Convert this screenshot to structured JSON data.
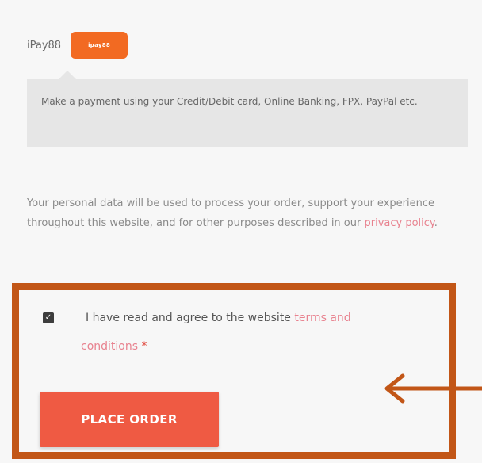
{
  "payment": {
    "method_name": "iPay88",
    "badge_text": "ipay88",
    "description": "Make a payment using your Credit/Debit card, Online Banking, FPX, PayPal etc."
  },
  "privacy": {
    "text": "Your personal data will be used to process your order, support your experience throughout this website, and for other purposes described in our ",
    "link_label": "privacy policy",
    "end": "."
  },
  "terms": {
    "checked": true,
    "text_line1": "I have read and agree to the website ",
    "link_part1": "terms and",
    "link_part2": "conditions",
    "required_mark": "*"
  },
  "actions": {
    "place_order_label": "PLACE ORDER"
  },
  "colors": {
    "accent": "#ef5a43",
    "badge": "#f26a22",
    "highlight": "#c25617",
    "link": "#e8828f"
  }
}
